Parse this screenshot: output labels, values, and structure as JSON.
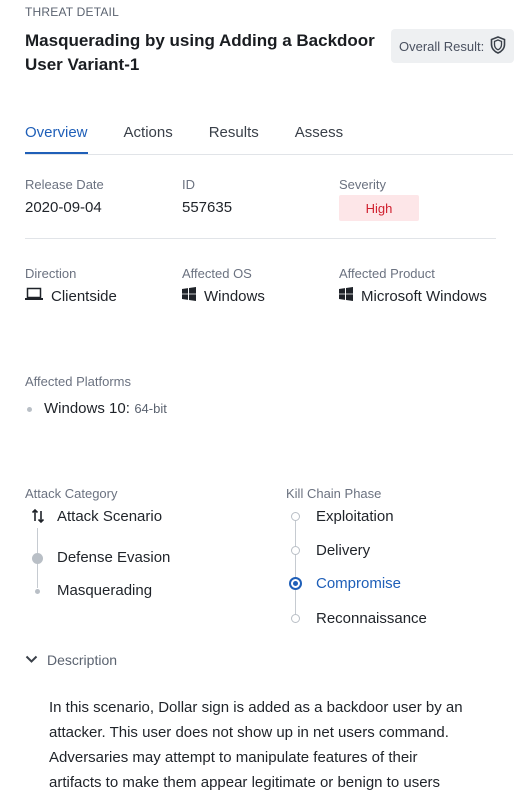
{
  "header": {
    "section": "THREAT DETAIL",
    "title": "Masquerading by using Adding a Backdoor User Variant-1",
    "overall_result_label": "Overall Result:"
  },
  "tabs": [
    {
      "label": "Overview",
      "active": true
    },
    {
      "label": "Actions",
      "active": false
    },
    {
      "label": "Results",
      "active": false
    },
    {
      "label": "Assess",
      "active": false
    }
  ],
  "overview": {
    "release_date_label": "Release Date",
    "release_date": "2020-09-04",
    "id_label": "ID",
    "id": "557635",
    "severity_label": "Severity",
    "severity": "High",
    "direction_label": "Direction",
    "direction": "Clientside",
    "affected_os_label": "Affected OS",
    "affected_os": "Windows",
    "affected_product_label": "Affected Product",
    "affected_product": "Microsoft Windows",
    "affected_platforms_label": "Affected Platforms",
    "platforms": [
      {
        "name": "Windows 10:",
        "arch": "64-bit"
      }
    ],
    "attack_category_label": "Attack Category",
    "attack_category": [
      "Attack Scenario",
      "Defense Evasion",
      "Masquerading"
    ],
    "kill_chain_label": "Kill Chain Phase",
    "kill_chain": [
      {
        "label": "Exploitation",
        "selected": false
      },
      {
        "label": "Delivery",
        "selected": false
      },
      {
        "label": "Compromise",
        "selected": true
      },
      {
        "label": "Reconnaissance",
        "selected": false
      }
    ],
    "description_label": "Description",
    "description_lines": [
      "In this scenario, Dollar sign is added as a backdoor user by an",
      "attacker. This user does not show up in net users command.",
      "Adversaries may attempt to manipulate features of their",
      "artifacts to make them appear legitimate or benign to users"
    ]
  },
  "colors": {
    "accent": "#1f5fb8",
    "severity_high_bg": "#fde6e8",
    "severity_high_text": "#d0202f"
  }
}
